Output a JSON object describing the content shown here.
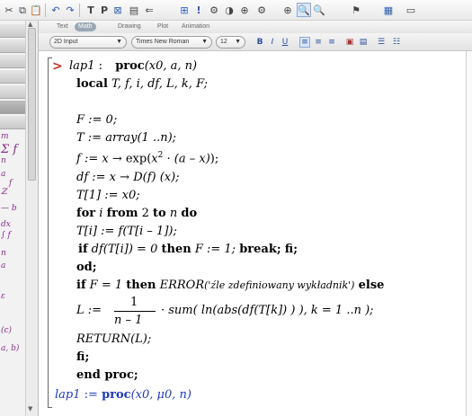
{
  "toolbar": {
    "buttons": [
      {
        "name": "cut-icon",
        "glyph": "✂"
      },
      {
        "name": "copy-icon",
        "glyph": "⧉"
      },
      {
        "name": "paste-icon",
        "glyph": "📋"
      },
      {
        "name": "undo-icon",
        "glyph": "↶"
      },
      {
        "name": "redo-icon",
        "glyph": "↷"
      },
      {
        "name": "insert-text-icon",
        "glyph": "T"
      },
      {
        "name": "insert-math-icon",
        "glyph": "P"
      },
      {
        "name": "plot-icon",
        "glyph": "⊠"
      },
      {
        "name": "execute-icon",
        "glyph": "▤"
      },
      {
        "name": "stop-icon",
        "glyph": "⇐"
      },
      {
        "name": "debug-icon",
        "glyph": "⊞"
      },
      {
        "name": "restart-icon",
        "glyph": "!"
      },
      {
        "name": "gear-icon",
        "glyph": "⚙"
      },
      {
        "name": "clear-icon",
        "glyph": "◑"
      },
      {
        "name": "magnify-icon",
        "glyph": "⊕"
      },
      {
        "name": "zoom-icon",
        "glyph": "🔍"
      },
      {
        "name": "flag-icon",
        "glyph": "⚑"
      },
      {
        "name": "help-icon",
        "glyph": "▦"
      },
      {
        "name": "window-icon",
        "glyph": "▭"
      }
    ]
  },
  "context_bar": {
    "tabs": [
      "Text",
      "Math",
      "Drawing",
      "Plot",
      "Animation"
    ],
    "active_tab": "Math"
  },
  "format_bar": {
    "style_value": "2D Input",
    "font_value": "Times New Roman",
    "size_value": "12",
    "bold_label": "B",
    "italic_label": "I",
    "underline_label": "U"
  },
  "palette": {
    "symbols": [
      "m",
      "Σ f",
      "n",
      "a",
      "f",
      "ℤ",
      "— b",
      "dx",
      "∫ f",
      "n",
      "a",
      "ε",
      "(c)",
      "a, b)"
    ]
  },
  "code": {
    "prompt": ">",
    "line1_name": "lap1",
    "line1_colon": ":",
    "line1_proc": "proc",
    "line1_args": "(x0, a, n)",
    "local_kw": "local",
    "local_vars": "T, f, i, df, L, k, F;",
    "F_assign": "F := 0;",
    "T_name": "T",
    "T_assign_rest": " := array(1 ..n);",
    "f_name": "f",
    "f_assign_a": " := x ",
    "f_arrow": "→",
    "f_assign_b": " exp",
    "f_paren_open": "(",
    "f_x": "x",
    "f_sup": "2",
    "f_mid": " · (a – x)",
    "f_paren_close": ");",
    "df_name": "df",
    "df_assign_a": " := x ",
    "df_arrow": "→",
    "df_assign_b": " D(f) (x);",
    "T1": "T[1] := x0;",
    "for_kw": "for",
    "for_i": "i",
    "from_kw": "from",
    "for_from": "2",
    "to_kw": "to",
    "for_n": "n",
    "do_kw": "do",
    "Ti_line": "T[i] := f(T[i – 1]);",
    "if_kw": "if",
    "if_cond": "df(T[i]) = 0",
    "then_kw": "then",
    "then_part": "F := 1;",
    "break_kw": "break;",
    "fi_kw": "fi;",
    "od_kw": "od;",
    "if2_kw": "if",
    "if2_cond": "F = 1",
    "then2_kw": "then",
    "error_kw": "ERROR",
    "error_msg": "('źle zdefiniowany wykładnik')",
    "else_kw": "else",
    "L_assign": "L := ",
    "frac_num": "1",
    "frac_den": "n – 1",
    "sum_expr": "· sum( ln(abs(df(T[k]) ) ), k = 1 ..n );",
    "return_expr": "RETURN(L);",
    "fi2": "fi;",
    "end_proc": "end proc;",
    "out_name": "lap1",
    "out_assign": " := ",
    "out_proc": "proc",
    "out_args": "(x0, μ0, n)"
  },
  "colors": {
    "prompt": "#c0302b",
    "output": "#1f3bb5",
    "palette_symbol": "#8a2b8a"
  }
}
